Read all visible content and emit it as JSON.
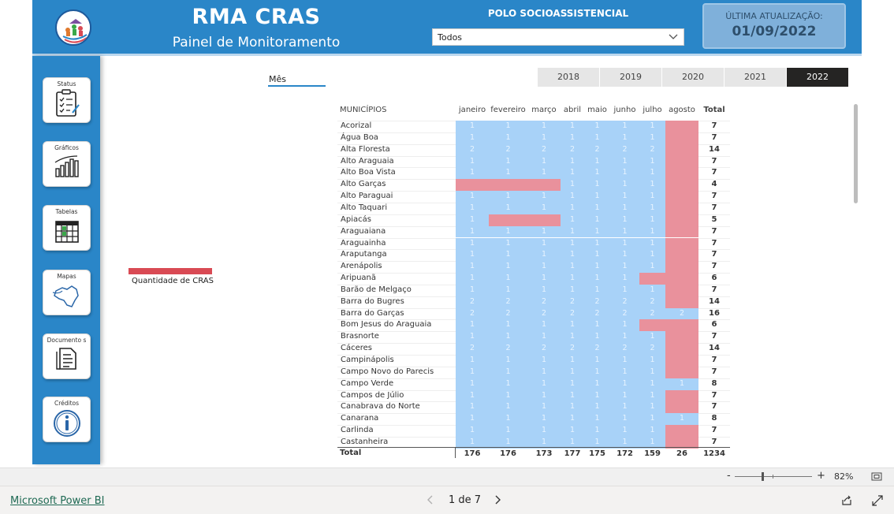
{
  "header": {
    "title": "RMA CRAS",
    "subtitle": "Painel de Monitoramento",
    "polo_label": "POLO SOCIOASSISTENCIAL",
    "polo_value": "Todos",
    "update_label": "ÚLTIMA ATUALIZAÇÃO:",
    "update_date": "01/09/2022"
  },
  "sidebar": {
    "items": [
      {
        "label": "Status",
        "icon": "clipboard-checklist-icon"
      },
      {
        "label": "Gráficos",
        "icon": "bar-chart-icon"
      },
      {
        "label": "Tabelas",
        "icon": "table-icon"
      },
      {
        "label": "Mapas",
        "icon": "map-icon"
      },
      {
        "label": "Documento s",
        "icon": "document-icon"
      },
      {
        "label": "Créditos",
        "icon": "info-icon"
      }
    ]
  },
  "filters": {
    "mes_label": "Mês",
    "years": [
      "2018",
      "2019",
      "2020",
      "2021",
      "2022"
    ],
    "selected_year": "2022"
  },
  "legend": {
    "label": "Quantidade de CRAS",
    "color": "#d94a54"
  },
  "colors": {
    "filled": "#a8d2f8",
    "empty": "#e9919c",
    "accent": "#2a86c8"
  },
  "matrix": {
    "row_header": "MUNICÍPIOS",
    "columns": [
      "janeiro",
      "fevereiro",
      "março",
      "abril",
      "maio",
      "junho",
      "julho",
      "agosto"
    ],
    "total_header": "Total",
    "rows": [
      {
        "name": "Acorizal",
        "values": [
          1,
          1,
          1,
          1,
          1,
          1,
          1,
          null
        ],
        "total": "7"
      },
      {
        "name": "Água Boa",
        "values": [
          1,
          1,
          1,
          1,
          1,
          1,
          1,
          null
        ],
        "total": "7"
      },
      {
        "name": "Alta Floresta",
        "values": [
          2,
          2,
          2,
          2,
          2,
          2,
          2,
          null
        ],
        "total": "14"
      },
      {
        "name": "Alto Araguaia",
        "values": [
          1,
          1,
          1,
          1,
          1,
          1,
          1,
          null
        ],
        "total": "7"
      },
      {
        "name": "Alto Boa Vista",
        "values": [
          1,
          1,
          1,
          1,
          1,
          1,
          1,
          null
        ],
        "total": "7"
      },
      {
        "name": "Alto Garças",
        "values": [
          null,
          null,
          null,
          1,
          1,
          1,
          1,
          null
        ],
        "total": "4"
      },
      {
        "name": "Alto Paraguai",
        "values": [
          1,
          1,
          1,
          1,
          1,
          1,
          1,
          null
        ],
        "total": "7"
      },
      {
        "name": "Alto Taquari",
        "values": [
          1,
          1,
          1,
          1,
          1,
          1,
          1,
          null
        ],
        "total": "7"
      },
      {
        "name": "Apiacás",
        "values": [
          1,
          null,
          null,
          1,
          1,
          1,
          1,
          null
        ],
        "total": "5"
      },
      {
        "name": "Araguaiana",
        "values": [
          1,
          1,
          1,
          1,
          1,
          1,
          1,
          null
        ],
        "total": "7"
      },
      {
        "name": "Araguainha",
        "values": [
          1,
          1,
          1,
          1,
          1,
          1,
          1,
          null
        ],
        "total": "7"
      },
      {
        "name": "Araputanga",
        "values": [
          1,
          1,
          1,
          1,
          1,
          1,
          1,
          null
        ],
        "total": "7"
      },
      {
        "name": "Arenápolis",
        "values": [
          1,
          1,
          1,
          1,
          1,
          1,
          1,
          null
        ],
        "total": "7"
      },
      {
        "name": "Aripuanã",
        "values": [
          1,
          1,
          1,
          1,
          1,
          1,
          null,
          null
        ],
        "total": "6"
      },
      {
        "name": "Barão de Melgaço",
        "values": [
          1,
          1,
          1,
          1,
          1,
          1,
          1,
          null
        ],
        "total": "7"
      },
      {
        "name": "Barra do Bugres",
        "values": [
          2,
          2,
          2,
          2,
          2,
          2,
          2,
          null
        ],
        "total": "14"
      },
      {
        "name": "Barra do Garças",
        "values": [
          2,
          2,
          2,
          2,
          2,
          2,
          2,
          2
        ],
        "total": "16"
      },
      {
        "name": "Bom Jesus do Araguaia",
        "values": [
          1,
          1,
          1,
          1,
          1,
          1,
          null,
          null
        ],
        "total": "6"
      },
      {
        "name": "Brasnorte",
        "values": [
          1,
          1,
          1,
          1,
          1,
          1,
          1,
          null
        ],
        "total": "7"
      },
      {
        "name": "Cáceres",
        "values": [
          2,
          2,
          2,
          2,
          2,
          2,
          2,
          null
        ],
        "total": "14"
      },
      {
        "name": "Campinápolis",
        "values": [
          1,
          1,
          1,
          1,
          1,
          1,
          1,
          null
        ],
        "total": "7"
      },
      {
        "name": "Campo Novo do Parecis",
        "values": [
          1,
          1,
          1,
          1,
          1,
          1,
          1,
          null
        ],
        "total": "7"
      },
      {
        "name": "Campo Verde",
        "values": [
          1,
          1,
          1,
          1,
          1,
          1,
          1,
          1
        ],
        "total": "8"
      },
      {
        "name": "Campos de Júlio",
        "values": [
          1,
          1,
          1,
          1,
          1,
          1,
          1,
          null
        ],
        "total": "7"
      },
      {
        "name": "Canabrava do Norte",
        "values": [
          1,
          1,
          1,
          1,
          1,
          1,
          1,
          null
        ],
        "total": "7"
      },
      {
        "name": "Canarana",
        "values": [
          1,
          1,
          1,
          1,
          1,
          1,
          1,
          1
        ],
        "total": "8"
      },
      {
        "name": "Carlinda",
        "values": [
          1,
          1,
          1,
          1,
          1,
          1,
          1,
          null
        ],
        "total": "7"
      },
      {
        "name": "Castanheira",
        "values": [
          1,
          1,
          1,
          1,
          1,
          1,
          1,
          null
        ],
        "total": "7"
      }
    ],
    "total_label": "Total",
    "column_totals": [
      "176",
      "176",
      "173",
      "177",
      "175",
      "172",
      "159",
      "26"
    ],
    "grand_total": "1234"
  },
  "footer": {
    "powerbi_link": "Microsoft Power BI",
    "pager": "1 de 7",
    "zoom_minus": "-",
    "zoom_plus": "+",
    "zoom": "82%",
    "zoom_level": 0.36
  }
}
